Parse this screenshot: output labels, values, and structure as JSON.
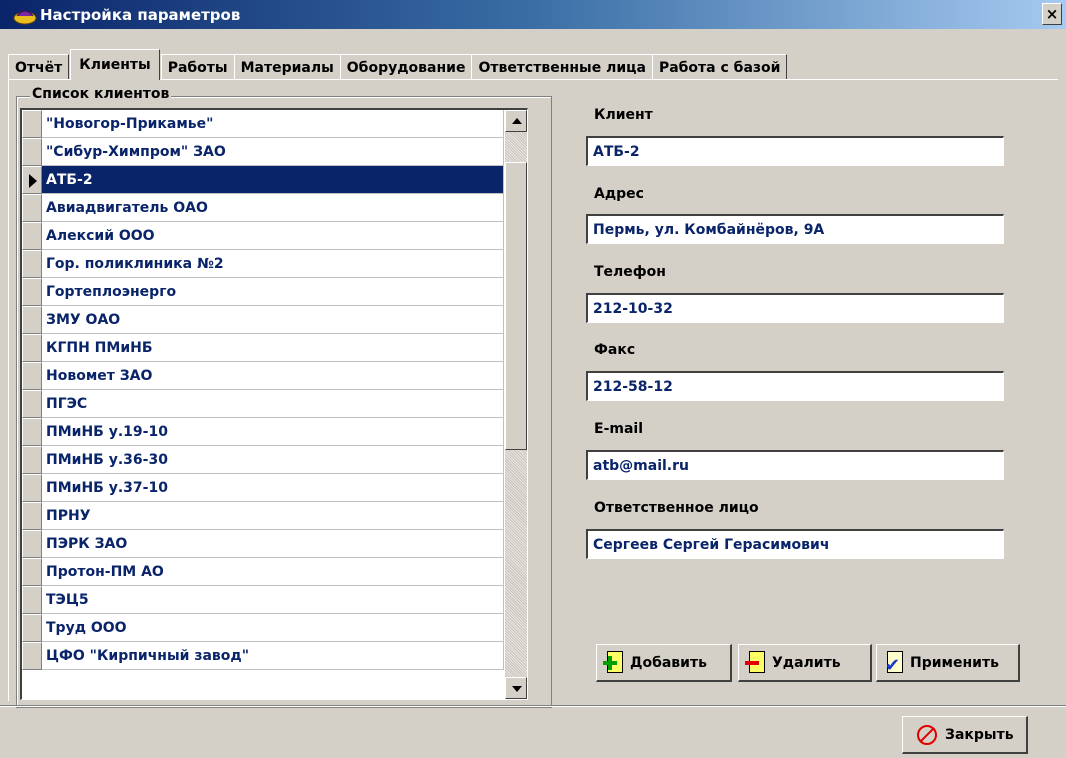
{
  "window": {
    "title": "Настройка параметров",
    "close_glyph": "×"
  },
  "tabs": [
    {
      "label": "Отчёт"
    },
    {
      "label": "Клиенты",
      "active": true
    },
    {
      "label": "Работы"
    },
    {
      "label": "Материалы"
    },
    {
      "label": "Оборудование"
    },
    {
      "label": "Ответственные лица"
    },
    {
      "label": "Работа с базой"
    }
  ],
  "client_list": {
    "label": "Список клиентов",
    "items": [
      "\"Новогор-Прикамье\"",
      "\"Сибур-Химпром\" ЗАО",
      "АТБ-2",
      "Авиадвигатель ОАО",
      "Алексий ООО",
      "Гор. поликлиника №2",
      "Гортеплоэнерго",
      "ЗМУ ОАО",
      "КГПН ПМиНБ",
      "Новомет ЗАО",
      "ПГЭС",
      "ПМиНБ у.19-10",
      "ПМиНБ у.36-30",
      "ПМиНБ у.37-10",
      "ПРНУ",
      "ПЭРК ЗАО",
      "Протон-ПМ АО",
      "ТЭЦ5",
      "Труд ООО",
      "ЦФО \"Кирпичный завод\""
    ],
    "selected_index": 2
  },
  "form": {
    "client_label": "Клиент",
    "client_value": "АТБ-2",
    "address_label": "Адрес",
    "address_value": "Пермь, ул. Комбайнёров, 9А",
    "phone_label": "Телефон",
    "phone_value": "212-10-32",
    "fax_label": "Факс",
    "fax_value": "212-58-12",
    "email_label": "E-mail",
    "email_value": "atb@mail.ru",
    "person_label": "Ответственное лицо",
    "person_value": "Сергеев Сергей Герасимович"
  },
  "buttons": {
    "add": "Добавить",
    "delete": "Удалить",
    "apply": "Применить",
    "close": "Закрыть"
  },
  "icons": {
    "window": "app-icon",
    "add": "add-document-icon",
    "delete": "delete-document-icon",
    "apply": "apply-check-icon",
    "close": "no-entry-icon"
  }
}
